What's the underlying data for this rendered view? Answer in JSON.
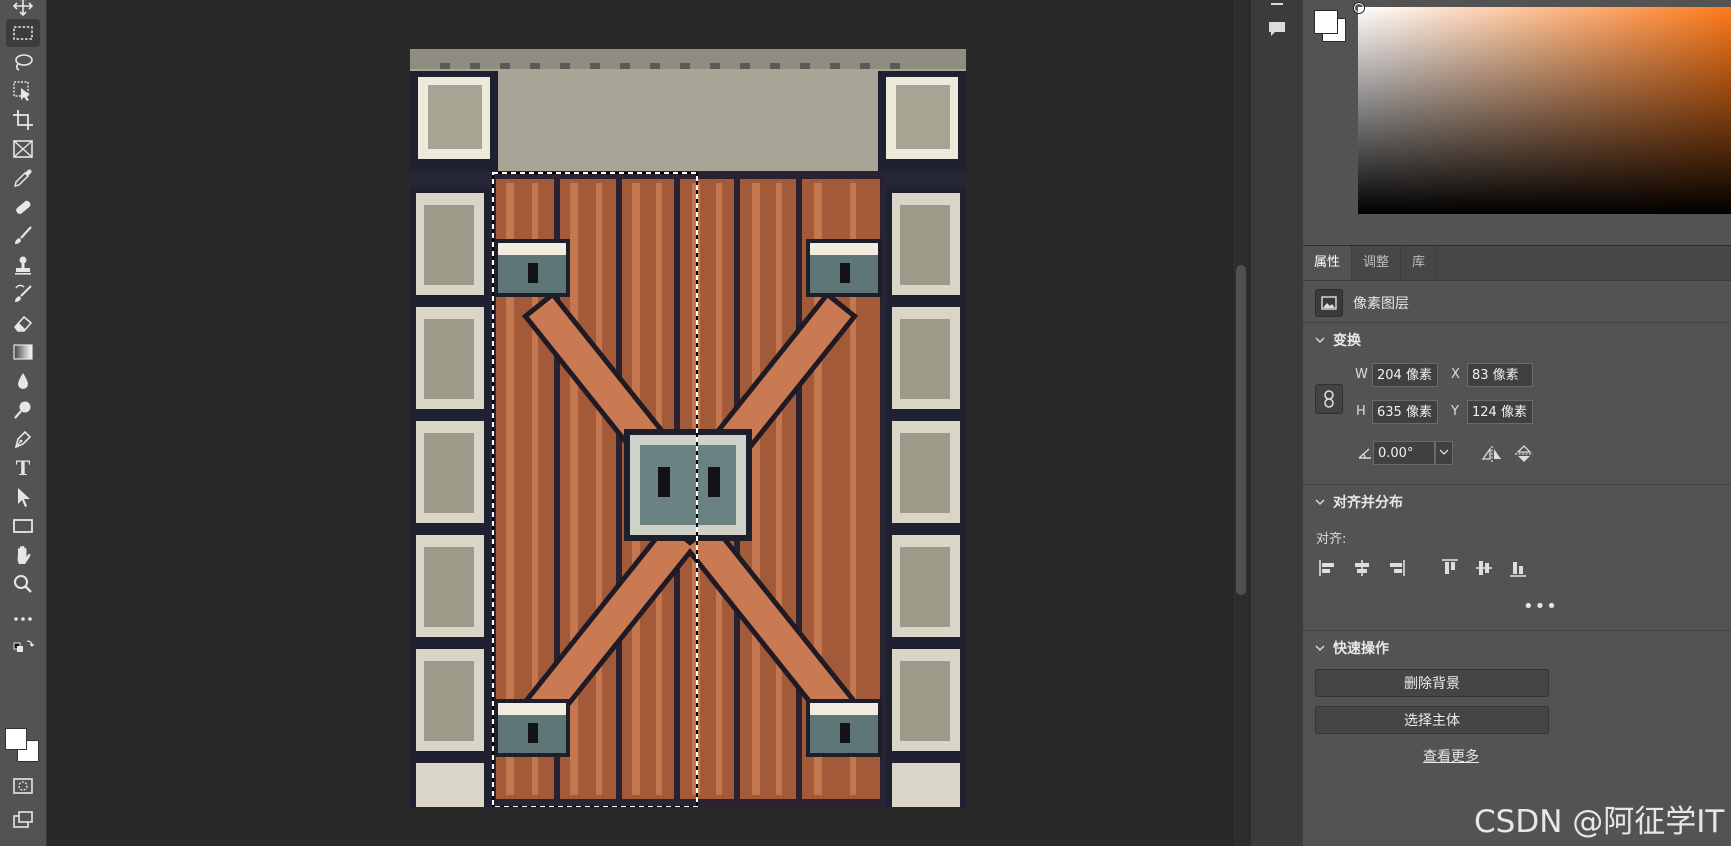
{
  "tools": [
    {
      "name": "move-tool",
      "icon": "move-icon"
    },
    {
      "name": "marquee-tool",
      "icon": "rectangle-marquee-icon",
      "active": true
    },
    {
      "name": "lasso-tool",
      "icon": "lasso-icon"
    },
    {
      "name": "object-select-tool",
      "icon": "object-selection-icon"
    },
    {
      "name": "crop-tool",
      "icon": "crop-icon"
    },
    {
      "name": "frame-tool",
      "icon": "frame-icon"
    },
    {
      "name": "eyedropper-tool",
      "icon": "eyedropper-icon"
    },
    {
      "name": "healing-brush-tool",
      "icon": "bandage-icon"
    },
    {
      "name": "brush-tool",
      "icon": "brush-icon"
    },
    {
      "name": "clone-stamp-tool",
      "icon": "stamp-icon"
    },
    {
      "name": "history-brush-tool",
      "icon": "history-brush-icon"
    },
    {
      "name": "eraser-tool",
      "icon": "eraser-icon"
    },
    {
      "name": "gradient-tool",
      "icon": "gradient-icon"
    },
    {
      "name": "blur-tool",
      "icon": "drop-icon"
    },
    {
      "name": "dodge-tool",
      "icon": "dodge-icon"
    },
    {
      "name": "pen-tool",
      "icon": "pen-icon"
    },
    {
      "name": "type-tool",
      "icon": "type-icon",
      "glyph": "T"
    },
    {
      "name": "path-select-tool",
      "icon": "arrow-icon"
    },
    {
      "name": "shape-tool",
      "icon": "rectangle-icon"
    },
    {
      "name": "hand-tool",
      "icon": "hand-icon"
    },
    {
      "name": "zoom-tool",
      "icon": "magnifier-icon"
    },
    {
      "name": "more-tools",
      "icon": "ellipsis-icon"
    }
  ],
  "properties": {
    "tabs": [
      "属性",
      "调整",
      "库"
    ],
    "active_tab": "属性",
    "layer_type": "像素图层",
    "transform": {
      "title": "变换",
      "w_label": "W",
      "w_value": "204 像素",
      "h_label": "H",
      "h_value": "635 像素",
      "x_label": "X",
      "x_value": "83 像素",
      "y_label": "Y",
      "y_value": "124 像素",
      "angle": "0.00°"
    },
    "align": {
      "title": "对齐并分布",
      "label": "对齐:",
      "more": "•••"
    },
    "quick_actions": {
      "title": "快速操作",
      "remove_bg": "删除背景",
      "select_subject": "选择主体",
      "see_more": "查看更多"
    }
  },
  "colors": {
    "foreground": "#ffffff",
    "background": "#ffffff",
    "picker_hue": "#ff7a1a"
  },
  "watermark": "CSDN @阿征学IT"
}
